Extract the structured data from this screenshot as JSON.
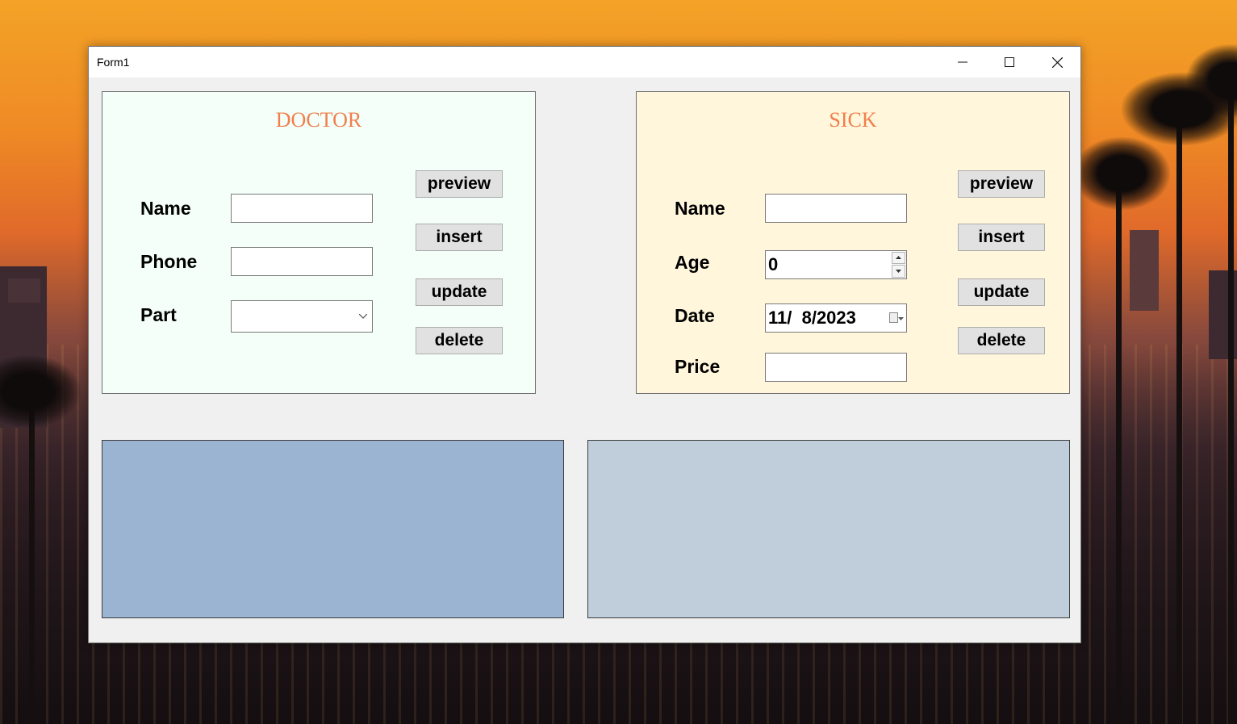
{
  "window": {
    "title": "Form1",
    "controls": {
      "minimize_icon": "minimize-icon",
      "maximize_icon": "maximize-icon",
      "close_icon": "close-icon"
    }
  },
  "doctor": {
    "title": "DOCTOR",
    "name_label": "Name",
    "phone_label": "Phone",
    "part_label": "Part",
    "name_value": "",
    "phone_value": "",
    "part_value": "",
    "buttons": {
      "preview": "preview",
      "insert": "insert",
      "update": "update",
      "delete": "delete"
    },
    "background": "#f4fff9"
  },
  "sick": {
    "title": "SICK",
    "name_label": "Name",
    "age_label": "Age",
    "date_label": "Date",
    "price_label": "Price",
    "name_value": "",
    "age_value": "0",
    "date_value": "11/  8/2023",
    "price_value": "",
    "buttons": {
      "preview": "preview",
      "insert": "insert",
      "update": "update",
      "delete": "delete"
    },
    "background": "#fff6dc"
  },
  "grids": {
    "doctor_grid_color": "#9ab4d1",
    "sick_grid_color": "#c0cedb"
  },
  "colors": {
    "title_accent": "#f07f4c",
    "form_bg": "#f0f0f0"
  }
}
